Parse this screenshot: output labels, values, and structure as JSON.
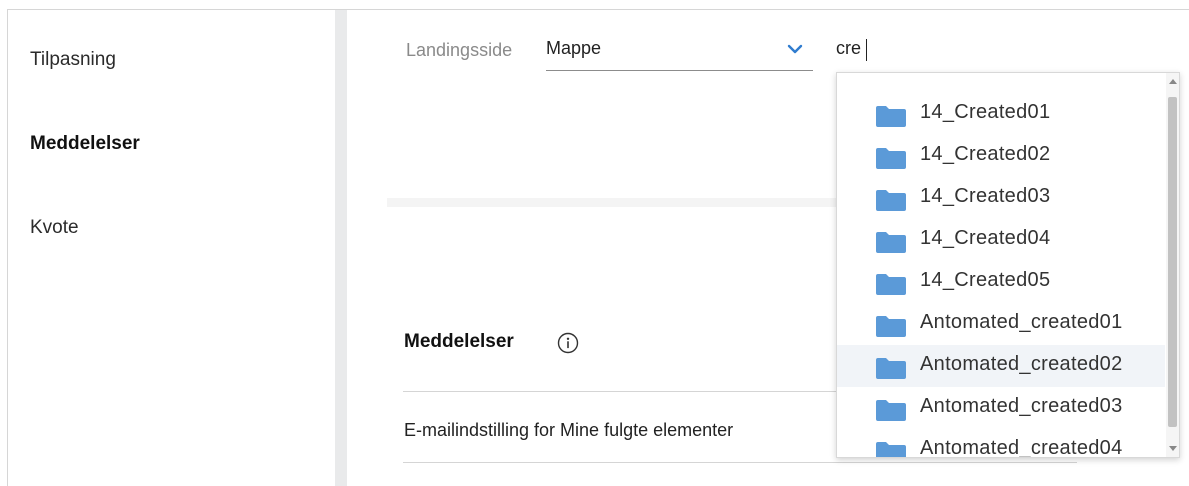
{
  "sidebar": {
    "items": [
      {
        "label": "Tilpasning",
        "active": false
      },
      {
        "label": "Meddelelser",
        "active": true
      },
      {
        "label": "Kvote",
        "active": false
      }
    ]
  },
  "landing": {
    "label": "Landingsside",
    "select_value": "Mappe"
  },
  "search": {
    "value": "cre"
  },
  "dropdown": {
    "items": [
      {
        "label": "14_Created01",
        "icon": "folder-icon"
      },
      {
        "label": "14_Created02",
        "icon": "folder-icon"
      },
      {
        "label": "14_Created03",
        "icon": "folder-icon"
      },
      {
        "label": "14_Created04",
        "icon": "folder-icon"
      },
      {
        "label": "14_Created05",
        "icon": "folder-icon"
      },
      {
        "label": "Antomated_created01",
        "icon": "folder-icon"
      },
      {
        "label": "Antomated_created02",
        "icon": "folder-icon",
        "hovered": true
      },
      {
        "label": "Antomated_created03",
        "icon": "folder-icon"
      },
      {
        "label": "Antomated_created04",
        "icon": "folder-icon"
      }
    ]
  },
  "notifications": {
    "title": "Meddelelser",
    "email_setting": "E-mailindstilling for Mine fulgte elementer"
  },
  "colors": {
    "accent": "#2f7ccf",
    "folder": "#5b9ad8",
    "hover_row": "#f1f4f8"
  }
}
